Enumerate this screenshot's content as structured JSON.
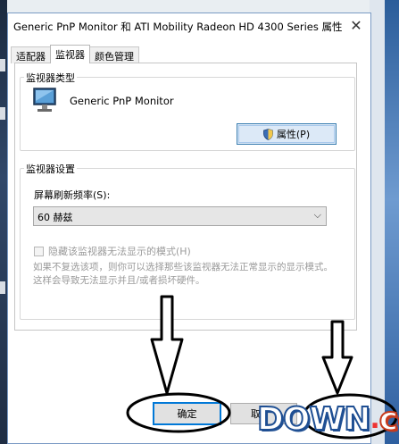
{
  "window": {
    "title": "Generic PnP Monitor 和 ATI Mobility Radeon HD 4300 Series 属性",
    "close_glyph": "✕"
  },
  "tabs": [
    {
      "label": "适配器",
      "active": false
    },
    {
      "label": "监视器",
      "active": true
    },
    {
      "label": "颜色管理",
      "active": false
    }
  ],
  "monitor_type": {
    "legend": "监视器类型",
    "name": "Generic PnP Monitor",
    "properties_button": "属性(P)",
    "icon": "monitor-icon"
  },
  "monitor_settings": {
    "legend": "监视器设置",
    "refresh_label": "屏幕刷新频率(S):",
    "refresh_value": "60 赫兹",
    "hide_modes_label": "隐藏该监视器无法显示的模式(H)",
    "hide_modes_checked": false,
    "hint": "如果不复选该项，则你可以选择那些该监视器无法正常显示的显示模式。这样会导致无法显示并且/或者损坏硬件。"
  },
  "footer": {
    "ok_label": "确定",
    "cancel_label": "取"
  },
  "watermark": {
    "main": "DOWN",
    "dot": ".",
    "cc": "cc"
  },
  "colors": {
    "accent": "#0078d7",
    "prop_button_bg": "#dce9f7",
    "annotation_ink": "#000000"
  }
}
